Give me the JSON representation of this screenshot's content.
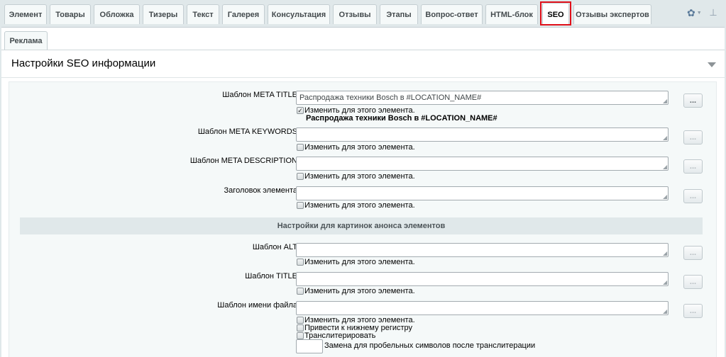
{
  "tabs": [
    {
      "label": "Элемент"
    },
    {
      "label": "Товары"
    },
    {
      "label": "Обложка"
    },
    {
      "label": "Тизеры"
    },
    {
      "label": "Текст"
    },
    {
      "label": "Галерея"
    },
    {
      "label": "Консультация"
    },
    {
      "label": "Отзывы"
    },
    {
      "label": "Этапы"
    },
    {
      "label": "Вопрос-ответ"
    },
    {
      "label": "HTML-блок"
    },
    {
      "label": "SEO"
    },
    {
      "label": "Отзывы экспертов"
    }
  ],
  "subtabs": [
    {
      "label": "Реклама"
    }
  ],
  "icons": {
    "settings": "gear-icon",
    "pin": "pin-icon",
    "collapse": "triangle-down-icon"
  },
  "section": {
    "title": "Настройки SEO информации"
  },
  "fields": {
    "meta_title": {
      "label": "Шаблон META TITLE",
      "value": "Распродажа техники Bosch в #LOCATION_NAME#",
      "checkbox": "Изменить для этого элемента.",
      "preview": "Распродажа техники Bosch в #LOCATION_NAME#"
    },
    "meta_keywords": {
      "label": "Шаблон META KEYWORDS",
      "value": "",
      "checkbox": "Изменить для этого элемента."
    },
    "meta_description": {
      "label": "Шаблон META DESCRIPTION",
      "value": "",
      "checkbox": "Изменить для этого элемента."
    },
    "element_heading": {
      "label": "Заголовок элемента",
      "value": "",
      "checkbox": "Изменить для этого элемента."
    }
  },
  "group": {
    "title": "Настройки для картинок анонса элементов"
  },
  "image_fields": {
    "alt": {
      "label": "Шаблон ALT",
      "value": "",
      "checkbox": "Изменить для этого элемента."
    },
    "title": {
      "label": "Шаблон TITLE",
      "value": "",
      "checkbox": "Изменить для этого элемента."
    },
    "filename": {
      "label": "Шаблон имени файла",
      "value": "",
      "checkbox": "Изменить для этого элемента.",
      "lowercase": "Привести к нижнему регистру",
      "transliterate": "Транслитерировать",
      "space_replace": "Замена для пробельных символов после транслитерации"
    }
  },
  "buttons": {
    "dots": "..."
  }
}
